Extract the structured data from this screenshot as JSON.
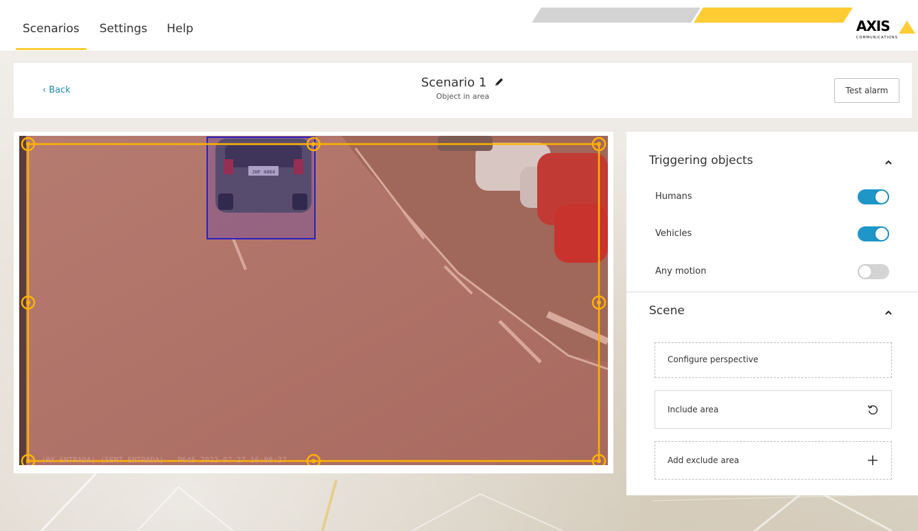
{
  "nav": {
    "tabs": [
      {
        "label": "Scenarios",
        "active": true
      },
      {
        "label": "Settings",
        "active": false
      },
      {
        "label": "Help",
        "active": false
      }
    ],
    "logo_text": "AXIS",
    "logo_sub": "COMMUNICATIONS"
  },
  "header": {
    "back_label": "Back",
    "title": "Scenario 1",
    "subtitle": "Object in area",
    "test_alarm_label": "Test alarm"
  },
  "video": {
    "overlay_text": "(RX ENTRADA) (SENT ENTRADA) - P645 2022-07-27 16:08:27",
    "plate_text": "JHF 4064"
  },
  "panel": {
    "triggering": {
      "title": "Triggering objects",
      "items": [
        {
          "label": "Humans",
          "enabled": true
        },
        {
          "label": "Vehicles",
          "enabled": true
        },
        {
          "label": "Any motion",
          "enabled": false
        }
      ]
    },
    "scene": {
      "title": "Scene",
      "configure_perspective": "Configure perspective",
      "include_area": "Include area",
      "add_exclude_area": "Add exclude area"
    }
  },
  "colors": {
    "accent_blue": "#1e96c8",
    "link_blue": "#1a8bb5",
    "area_yellow": "#ffb300",
    "brand_yellow": "#ffcc33",
    "detection_box": "#2a1fbf"
  }
}
